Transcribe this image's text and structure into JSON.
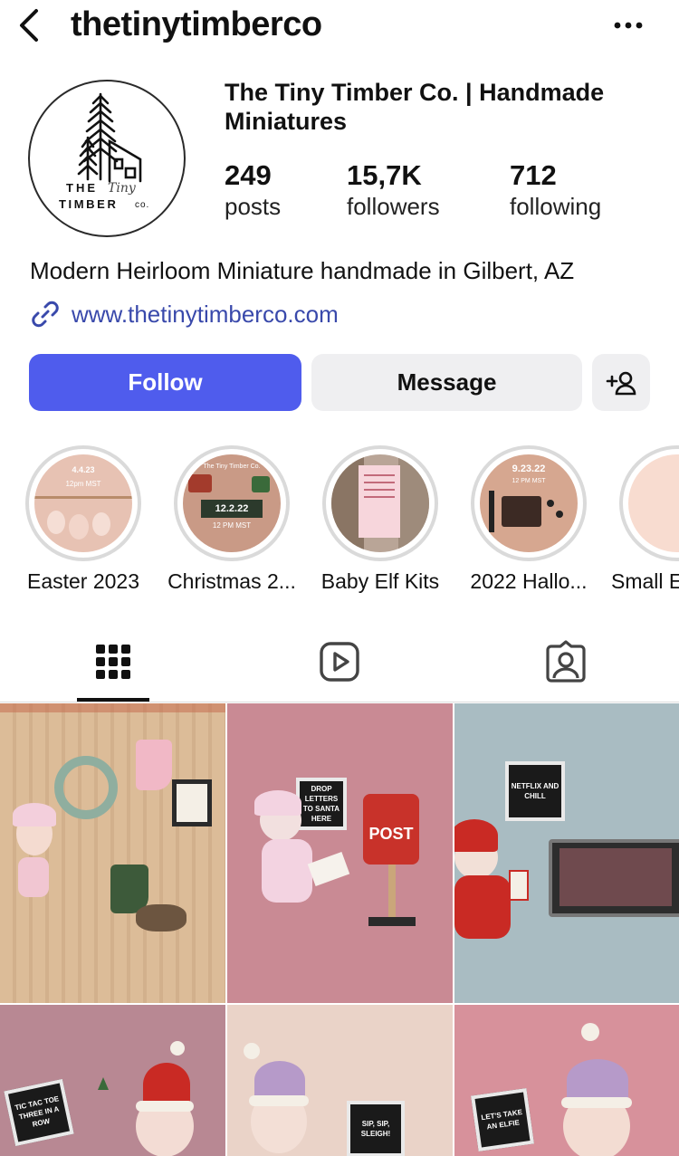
{
  "header": {
    "username": "thetinytimberco"
  },
  "profile": {
    "full_name": "The Tiny Timber Co. | Handmade Miniatures",
    "logo_text_line1": "THE",
    "logo_text_line2": "TIMBER",
    "logo_text_co": "co.",
    "logo_script": "Tiny",
    "stats": [
      {
        "value": "249",
        "label": "posts"
      },
      {
        "value": "15,7K",
        "label": "followers"
      },
      {
        "value": "712",
        "label": "following"
      }
    ],
    "bio": "Modern Heirloom Miniature handmade in Gilbert, AZ",
    "website": "www.thetinytimberco.com"
  },
  "actions": {
    "follow_label": "Follow",
    "message_label": "Message",
    "add_user_icon": "person-add-icon"
  },
  "highlights": [
    {
      "label": "Easter 2023",
      "badge": "4.4.23",
      "sub": "12pm MST"
    },
    {
      "label": "Christmas 2...",
      "badge": "12.2.22",
      "sub": "12 PM MST",
      "top": "The Tiny Timber Co."
    },
    {
      "label": "Baby Elf Kits"
    },
    {
      "label": "2022 Hallo...",
      "badge": "9.23.22",
      "sub": "12 PM MST"
    },
    {
      "label": "Small E"
    }
  ],
  "tabs": [
    {
      "name": "grid-tab",
      "icon": "grid-icon",
      "active": true
    },
    {
      "name": "reels-tab",
      "icon": "reels-icon",
      "active": false
    },
    {
      "name": "tagged-tab",
      "icon": "tagged-icon",
      "active": false
    }
  ],
  "posts": [
    {
      "board": ""
    },
    {
      "board": "DROP LETTERS TO SANTA HERE",
      "sign": "POST"
    },
    {
      "board": "NETFLIX AND CHILL"
    },
    {
      "board": "TIC TAC TOE THREE IN A ROW"
    },
    {
      "board": "SIP, SIP, SLEIGH!"
    },
    {
      "board": "LET'S TAKE AN ELFIE"
    }
  ],
  "colors": {
    "follow_button": "#4f5ced",
    "secondary_button": "#efeff1",
    "link": "#3949ab"
  }
}
